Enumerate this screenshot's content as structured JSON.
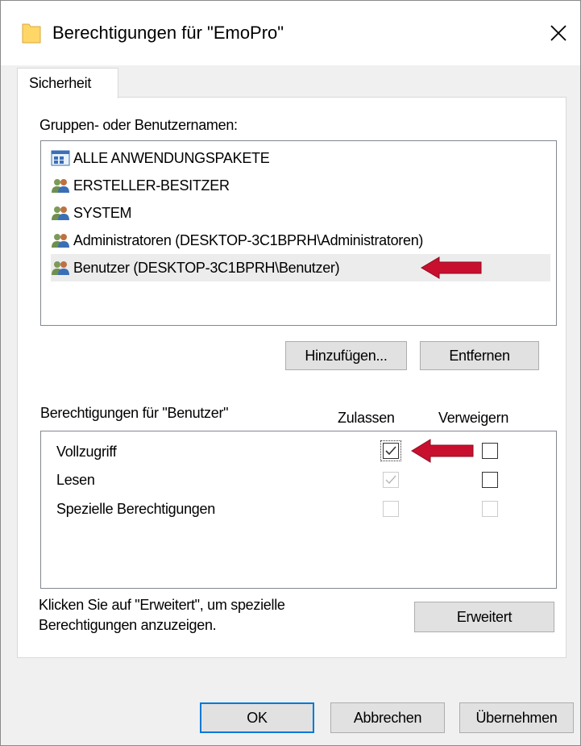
{
  "window": {
    "title": "Berechtigungen für \"EmoPro\""
  },
  "tabs": [
    {
      "label": "Sicherheit"
    }
  ],
  "groups": {
    "label": "Gruppen- oder Benutzernamen:",
    "items": [
      {
        "name": "ALLE ANWENDUNGSPAKETE",
        "icon": "app-packages-icon"
      },
      {
        "name": "ERSTELLER-BESITZER",
        "icon": "users-icon"
      },
      {
        "name": "SYSTEM",
        "icon": "users-icon"
      },
      {
        "name": "Administratoren (DESKTOP-3C1BPRH\\Administratoren)",
        "icon": "users-icon"
      },
      {
        "name": "Benutzer (DESKTOP-3C1BPRH\\Benutzer)",
        "icon": "users-icon",
        "selected": true
      }
    ],
    "add_button": "Hinzufügen...",
    "remove_button": "Entfernen"
  },
  "permissions": {
    "label": "Berechtigungen für \"Benutzer\"",
    "col_allow": "Zulassen",
    "col_deny": "Verweigern",
    "rows": [
      {
        "name": "Vollzugriff",
        "allow": "checked",
        "deny": "unchecked"
      },
      {
        "name": "Lesen",
        "allow": "checked-disabled",
        "deny": "unchecked"
      },
      {
        "name": "Spezielle Berechtigungen",
        "allow": "unchecked-disabled",
        "deny": "unchecked-disabled"
      }
    ]
  },
  "advanced": {
    "hint_line1": "Klicken Sie auf \"Erweitert\", um spezielle",
    "hint_line2": "Berechtigungen anzuzeigen.",
    "button": "Erweitert"
  },
  "footer": {
    "ok": "OK",
    "cancel": "Abbrechen",
    "apply": "Übernehmen"
  },
  "colors": {
    "annotation_arrow": "#c8102e",
    "default_button_border": "#0078d7",
    "selected_row": "#ececec"
  }
}
